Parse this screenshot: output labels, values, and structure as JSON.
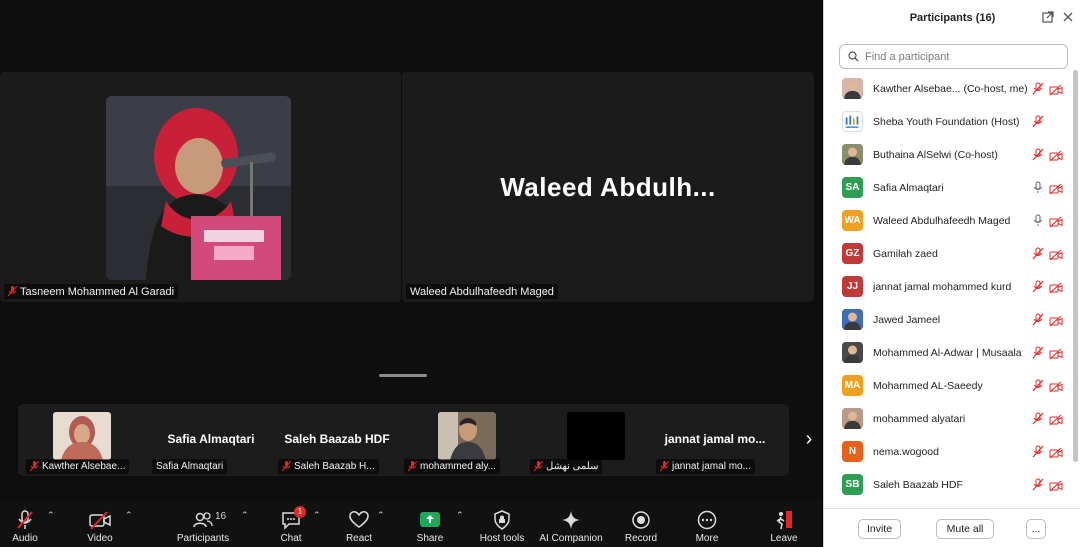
{
  "stage": {
    "main_speaker_name": "Tasneem Mohammed Al Garadi",
    "second_tile_big_name": "Waleed  Abdulh...",
    "second_tile_name": "Waleed Abdulhafeedh Maged"
  },
  "strip": {
    "thumbs": [
      {
        "big_name": "",
        "tag": "Kawther Alsebae..."
      },
      {
        "big_name": "Safia Almaqtari",
        "tag": "Safia Almaqtari"
      },
      {
        "big_name": "Saleh Baazab HDF",
        "tag": "Saleh Baazab H..."
      },
      {
        "big_name": "",
        "tag": "mohammed aly..."
      },
      {
        "big_name": "",
        "tag": "سلمى نهشل"
      },
      {
        "big_name": "jannat jamal mo...",
        "tag": "jannat jamal mo..."
      }
    ],
    "next_icon": "chevron-right-icon"
  },
  "toolbar": {
    "audio": "Audio",
    "video": "Video",
    "participants": "Participants",
    "participants_count": "16",
    "chat": "Chat",
    "chat_badge": "1",
    "react": "React",
    "share": "Share",
    "host_tools": "Host tools",
    "ai_companion": "AI Companion",
    "record": "Record",
    "more": "More",
    "leave": "Leave"
  },
  "panel": {
    "title": "Participants (16)",
    "search_placeholder": "Find a participant",
    "participants": [
      {
        "name": "Kawther Alsebae...  (Co-host, me)",
        "avatar": "photo",
        "color": "#d9b4a8",
        "mic": "off",
        "cam": "off"
      },
      {
        "name": "Sheba Youth Foundation (Host)",
        "avatar": "logo",
        "color": "#ffffff",
        "mic": "off",
        "cam": "none"
      },
      {
        "name": "Buthaina AlSelwi (Co-host)",
        "avatar": "photo",
        "color": "#8a8f6a",
        "mic": "off",
        "cam": "off"
      },
      {
        "name": "Safia Almaqtari",
        "avatar": "SA",
        "color": "#2e9e52",
        "mic": "on",
        "cam": "off"
      },
      {
        "name": "Waleed Abdulhafeedh Maged",
        "avatar": "WA",
        "color": "#f0a020",
        "mic": "on",
        "cam": "off"
      },
      {
        "name": "Gamilah zaed",
        "avatar": "GZ",
        "color": "#c03a3a",
        "mic": "off",
        "cam": "off"
      },
      {
        "name": "jannat jamal mohammed kurd",
        "avatar": "JJ",
        "color": "#c03a3a",
        "mic": "off",
        "cam": "off"
      },
      {
        "name": "Jawed Jameel",
        "avatar": "photo",
        "color": "#3f6fb0",
        "mic": "off",
        "cam": "off"
      },
      {
        "name": "Mohammed Al-Adwar | Musaala",
        "avatar": "photo",
        "color": "#4a4a4a",
        "mic": "off",
        "cam": "off"
      },
      {
        "name": "Mohammed AL-Saeedy",
        "avatar": "MA",
        "color": "#f0a020",
        "mic": "off",
        "cam": "off"
      },
      {
        "name": "mohammed alyatari",
        "avatar": "photo",
        "color": "#b99a88",
        "mic": "off",
        "cam": "off"
      },
      {
        "name": "nema.wogood",
        "avatar": "N",
        "color": "#e8601c",
        "mic": "off",
        "cam": "off"
      },
      {
        "name": "Saleh Baazab HDF",
        "avatar": "SB",
        "color": "#2e9e52",
        "mic": "off",
        "cam": "off"
      }
    ],
    "footer": {
      "invite": "Invite",
      "mute_all": "Mute all",
      "more": "..."
    }
  },
  "colors": {
    "stage_bg": "#0e0e0e",
    "tile_bg": "#1b1b1b",
    "mic_off_red": "#e02828",
    "share_green": "#1ea85a"
  }
}
